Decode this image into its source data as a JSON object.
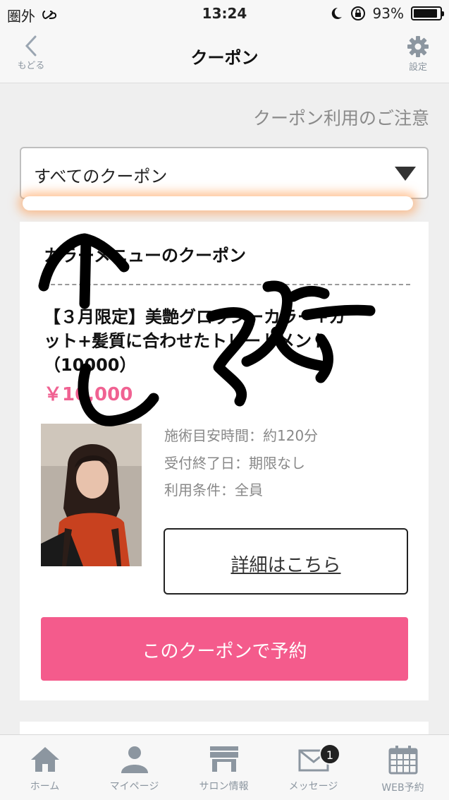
{
  "status_bar": {
    "carrier": "圏外",
    "time": "13:24",
    "battery_percent_label": "93%",
    "battery_level": 0.93
  },
  "nav": {
    "back_label": "もどる",
    "title": "クーポン",
    "settings_label": "設定"
  },
  "notice_link": "クーポン利用のご注意",
  "filter": {
    "selected": "すべてのクーポン"
  },
  "coupon": {
    "category": "カラーメニューのクーポン",
    "title_line1": "【３月限定】美艶グロッシーカラー+カ",
    "title_line2": "ット+髪質に合わせたトリートメント",
    "title_line3": "（10000）",
    "price": "￥10,000",
    "details": [
      "施術目安時間：約120分",
      "受付終了日：期限なし",
      "利用条件：全員"
    ],
    "detail_button": "詳細はこちら",
    "reserve_button": "このクーポンで予約"
  },
  "tabs": [
    {
      "label": "ホーム",
      "icon": "home-icon"
    },
    {
      "label": "マイページ",
      "icon": "person-icon"
    },
    {
      "label": "サロン情報",
      "icon": "shop-icon"
    },
    {
      "label": "メッセージ",
      "icon": "envelope-icon",
      "badge": "1"
    },
    {
      "label": "WEB予約",
      "icon": "calendar-icon"
    }
  ],
  "colors": {
    "accent_pink": "#f45b8c",
    "price_pink": "#f06292",
    "icon_gray": "#8c96a0"
  }
}
